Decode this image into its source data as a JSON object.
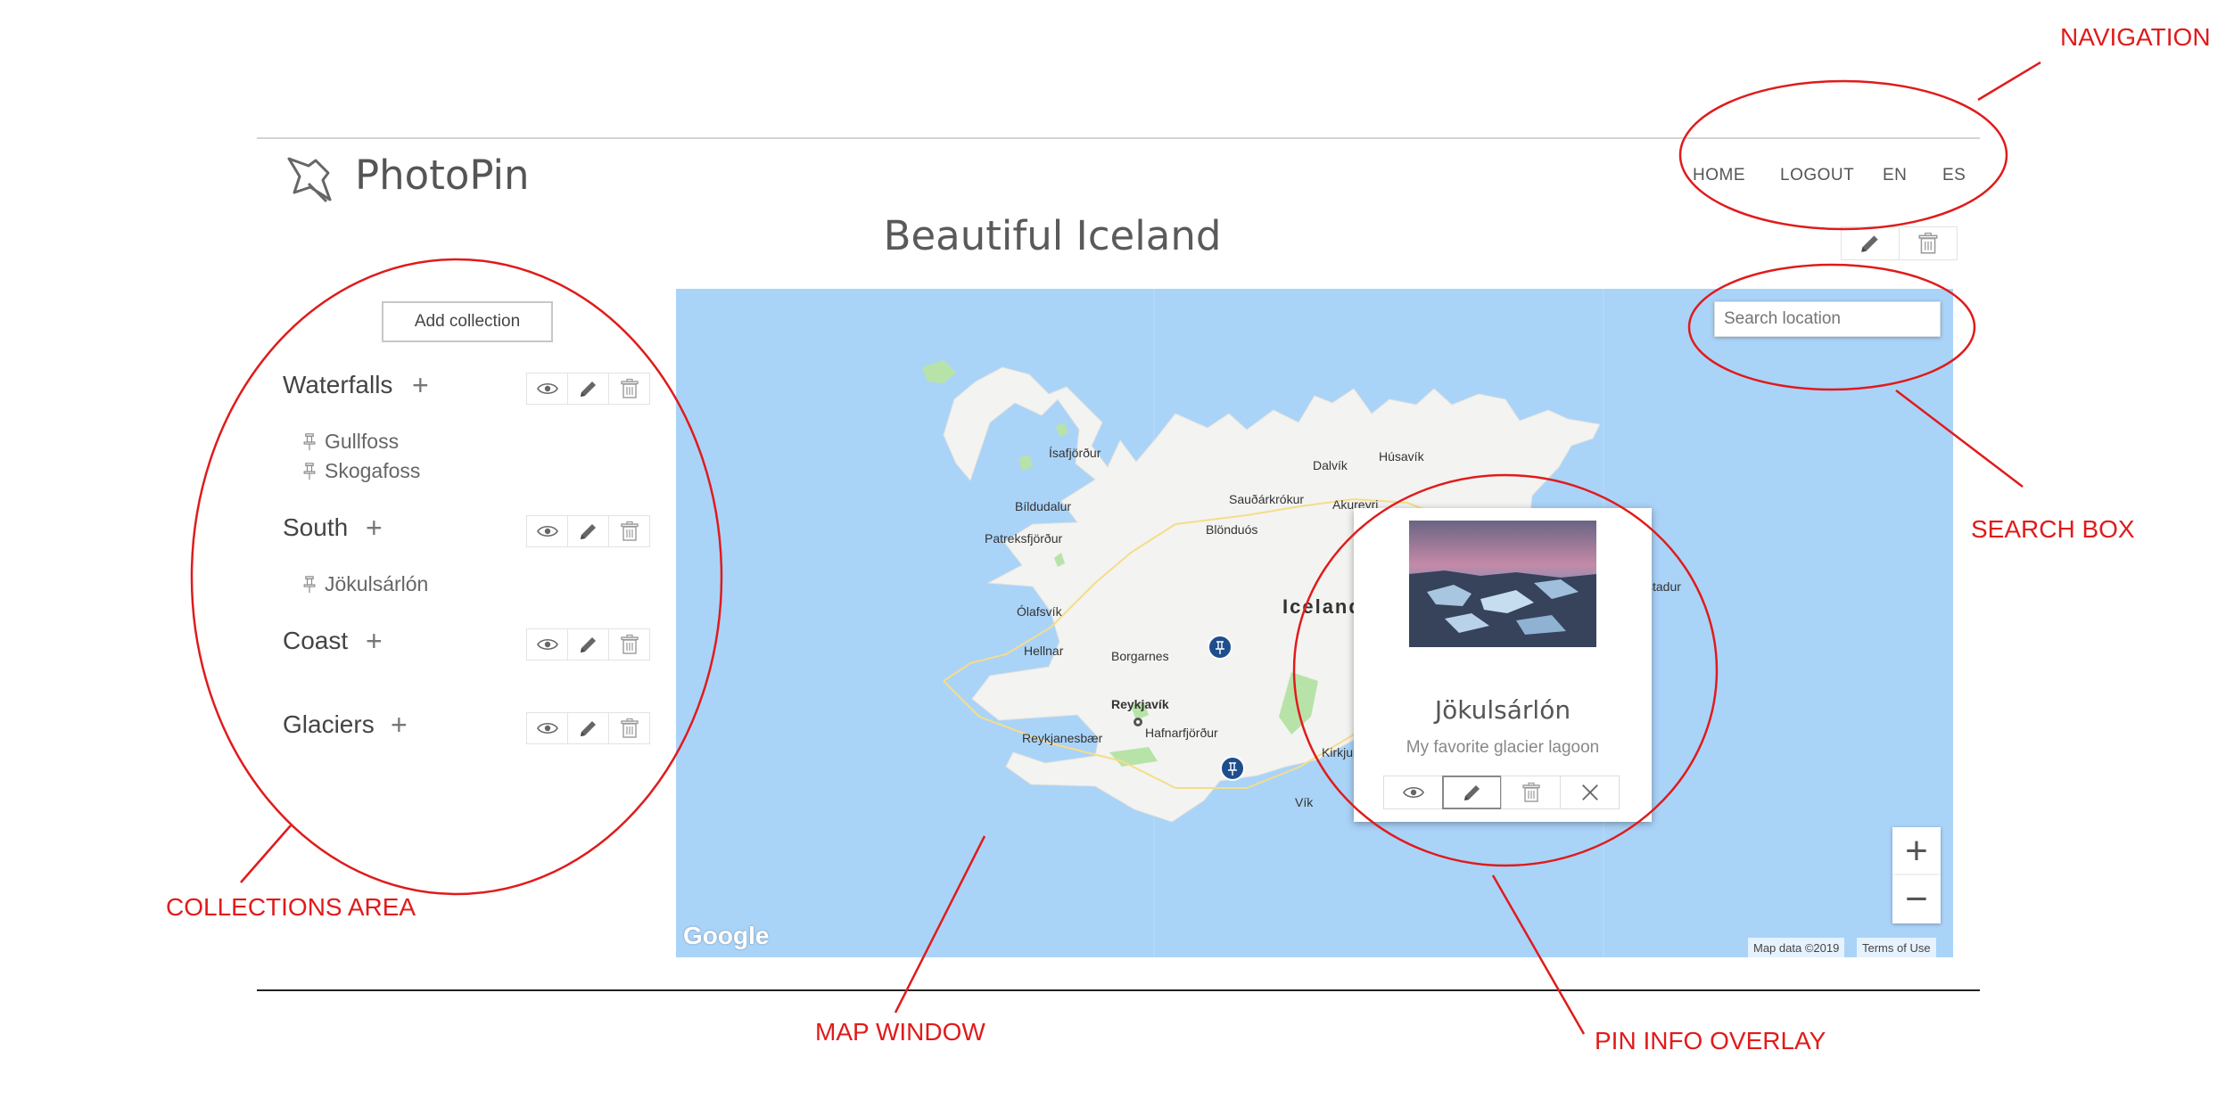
{
  "app": {
    "brand": "PhotoPin",
    "logo_icon": "pushpin-icon"
  },
  "nav": {
    "items": [
      "HOME",
      "LOGOUT",
      "EN",
      "ES"
    ]
  },
  "page": {
    "title": "Beautiful Iceland",
    "edit_icon": "pencil-icon",
    "delete_icon": "trash-icon"
  },
  "collections": {
    "add_label": "Add collection",
    "items": [
      {
        "name": "Waterfalls",
        "pins": [
          "Gullfoss",
          "Skogafoss"
        ]
      },
      {
        "name": "South",
        "pins": [
          "Jökulsárlón"
        ]
      },
      {
        "name": "Coast",
        "pins": []
      },
      {
        "name": "Glaciers",
        "pins": []
      }
    ],
    "add_icon": "plus-icon",
    "action_icons": [
      "eye-icon",
      "pencil-icon",
      "trash-icon"
    ]
  },
  "map": {
    "search_placeholder": "Search location",
    "place_labels": [
      "Ísafjörður",
      "Bíldudalur",
      "Patreksfjörður",
      "Ólafsvík",
      "Hellnar",
      "Borgarnes",
      "Reykjavík",
      "Hafnarfjörður",
      "Reykjanesbær",
      "Sauðárkrókur",
      "Blönduós",
      "Dalvík",
      "Akureyri",
      "Húsavík",
      "Iceland",
      "Kirkjubæjar",
      "Vík",
      "stadur"
    ],
    "zoom_in": "+",
    "zoom_out": "−",
    "google": "Google",
    "map_data": "Map data ©2019",
    "terms": "Terms of Use",
    "colors": {
      "water": "#aad3f8",
      "land": "#f3f3f1",
      "green": "#b7e3a8",
      "pin": "#1e4e8c"
    }
  },
  "pin_overlay": {
    "title": "Jökulsárlón",
    "description": "My favorite glacier lagoon",
    "buttons": [
      "eye-icon",
      "pencil-icon",
      "trash-icon",
      "close-icon"
    ]
  },
  "annotations": {
    "navigation": "NAVIGATION",
    "search_box": "SEARCH BOX",
    "collections_area": "COLLECTIONS AREA",
    "map_window": "MAP WINDOW",
    "pin_info_overlay": "PIN INFO OVERLAY",
    "color": "#e01b1b"
  }
}
